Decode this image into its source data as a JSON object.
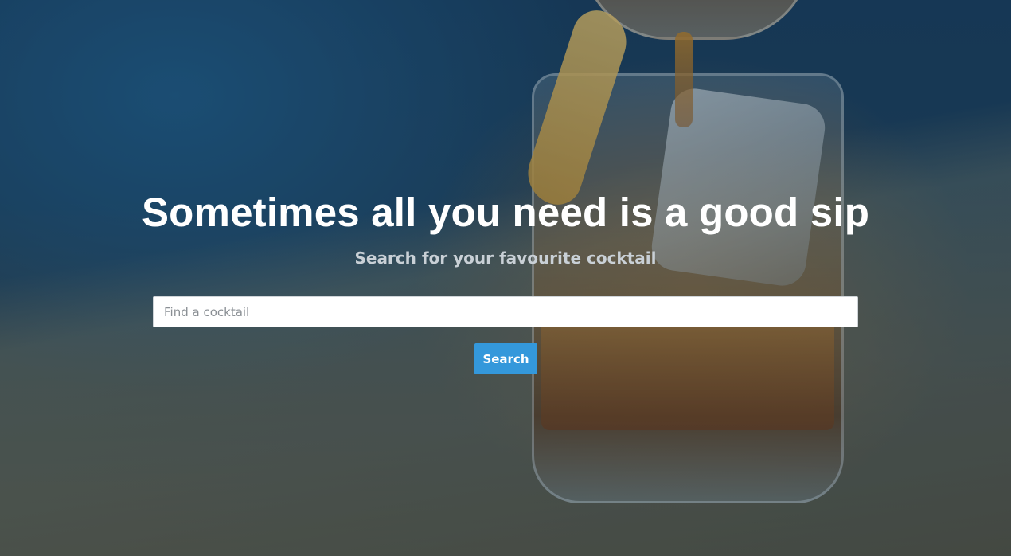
{
  "hero": {
    "headline": "Sometimes all you need is a good sip",
    "subheadline": "Search for your favourite cocktail",
    "background_image": "cocktail-glass-photo"
  },
  "search": {
    "placeholder": "Find a cocktail",
    "value": "",
    "button_label": "Search"
  },
  "colors": {
    "accent": "#3498db",
    "headline": "#ffffff",
    "subheadline": "#c9d0d6"
  }
}
